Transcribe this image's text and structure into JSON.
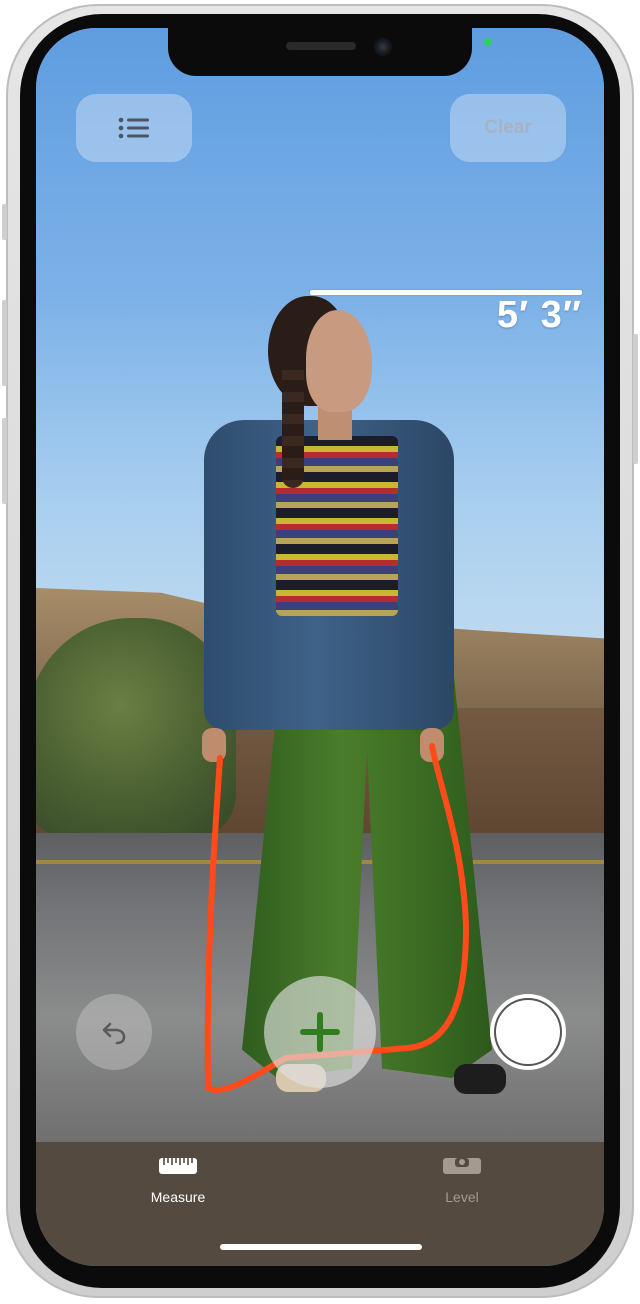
{
  "app": {
    "name": "Measure"
  },
  "toolbar": {
    "list_icon": "list-icon",
    "clear_label": "Clear"
  },
  "measurement": {
    "label": "5′ 3″"
  },
  "controls": {
    "undo_icon": "undo-icon",
    "add_icon": "plus-icon",
    "capture_icon": "shutter-icon"
  },
  "tabs": [
    {
      "label": "Measure",
      "icon": "ruler-icon",
      "active": true
    },
    {
      "label": "Level",
      "icon": "level-icon",
      "active": false
    }
  ],
  "colors": {
    "measure_line": "#ffffff",
    "tabbar_bg": "#544a40",
    "active_tab": "#ffffff",
    "inactive_tab": "#a39a90",
    "add_plus": "#2f7d1f"
  }
}
